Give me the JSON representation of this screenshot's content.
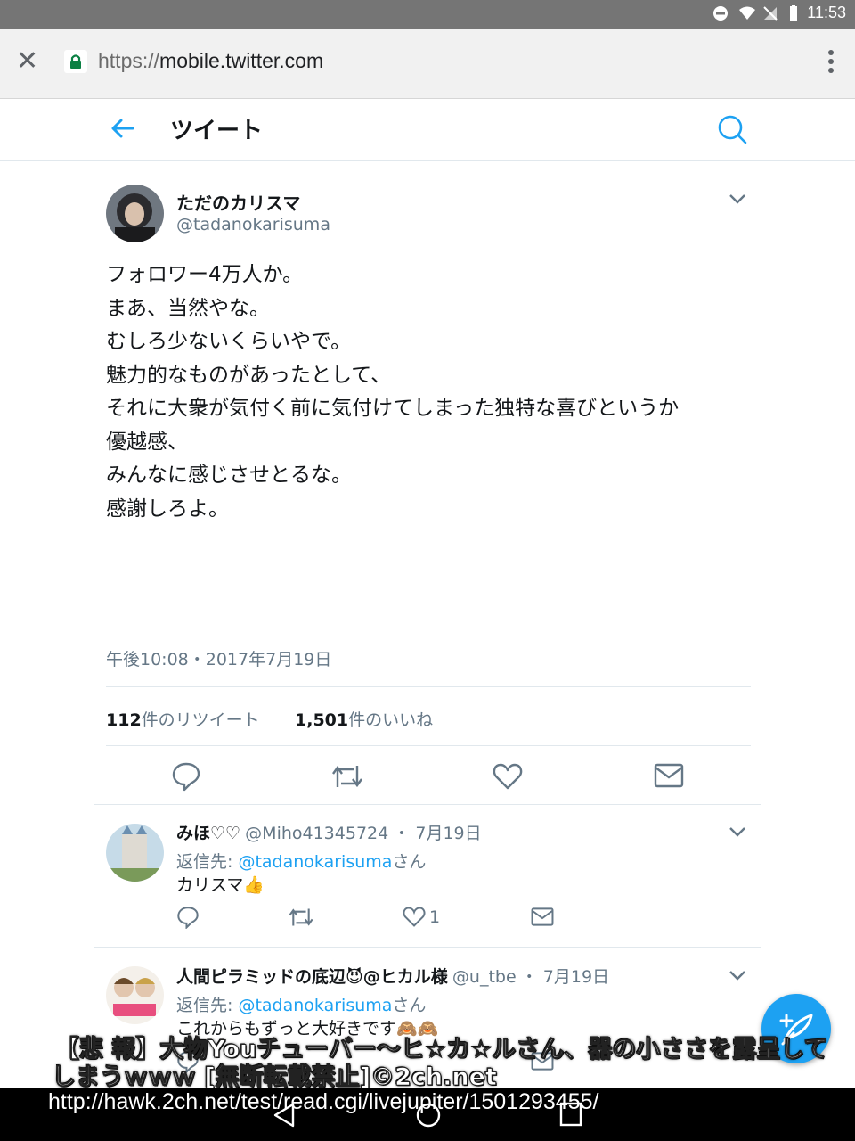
{
  "status_bar": {
    "time": "11:53"
  },
  "browser": {
    "url_scheme": "https://",
    "url_host": "mobile.twitter.com"
  },
  "header": {
    "title": "ツイート"
  },
  "tweet": {
    "name": "ただのカリスマ",
    "handle": "@tadanokarisuma",
    "lines": [
      "フォロワー4万人か。",
      "まあ、当然やな。",
      "",
      "むしろ少ないくらいやで。",
      "",
      "魅力的なものがあったとして、",
      "それに大衆が気付く前に気付けてしまった独特な喜びというか",
      "優越感、",
      "",
      "みんなに感じさせとるな。",
      "感謝しろよ。"
    ],
    "timestamp": "午後10:08・2017年7月19日",
    "retweet_count": "112",
    "retweet_label": "件のリツイート",
    "like_count": "1,501",
    "like_label": "件のいいね"
  },
  "replies": [
    {
      "name": "みほ♡♡",
      "handle": "@Miho41345724",
      "date": "・ 7月19日",
      "reply_prefix": "返信先: ",
      "reply_to": "@tadanokarisuma",
      "reply_suffix": "さん",
      "text": "カリスマ👍",
      "like_count": "1"
    },
    {
      "name": "人間ピラミッドの底辺😈@ヒカル様",
      "handle": "@u_tbe",
      "date": "・ 7月19日",
      "reply_prefix": "返信先: ",
      "reply_to": "@tadanokarisuma",
      "reply_suffix": "さん",
      "text": "これからもずっと大好きです🙈🙈",
      "like_count": ""
    }
  ],
  "overlay": {
    "caption_line1": "【悲 報】大物Youチューバー～ヒ☆カ☆ルさん、器の小ささを露呈して",
    "caption_line2": "しまうｗｗｗ [無断転載禁止]©2ch.net",
    "source_url": "http://hawk.2ch.net/test/read.cgi/livejupiter/1501293455/"
  },
  "colors": {
    "accent": "#1da1f2",
    "status_bar": "#757575",
    "chrome_bar": "#f1f1f1",
    "muted_text": "#657786"
  }
}
